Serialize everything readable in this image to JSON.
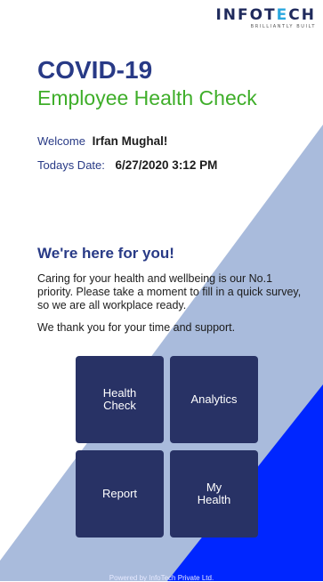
{
  "logo": {
    "word_start": "INFOT",
    "word_accent": "E",
    "word_end": "CH",
    "tagline": "BRILLIANTLY BUILT"
  },
  "header": {
    "title": "COVID-19",
    "subtitle": "Employee Health Check"
  },
  "welcome": {
    "label": "Welcome",
    "name": "Irfan Mughal!"
  },
  "date": {
    "label": "Todays Date:",
    "value": "6/27/2020 3:12 PM"
  },
  "message": {
    "heading": "We're here for you!",
    "body": "Caring for your health and wellbeing is our No.1 priority. Please take a moment to fill in a quick survey, so we are all workplace ready.",
    "thanks": "We thank you for your time and support."
  },
  "tiles": [
    {
      "label": "Health\nCheck"
    },
    {
      "label": "Analytics"
    },
    {
      "label": "Report"
    },
    {
      "label": "My\nHealth"
    }
  ],
  "footer": "Powered by InfoTech Private Ltd.",
  "colors": {
    "primary": "#283a86",
    "accent_green": "#3fae2a",
    "tile": "#283265",
    "blue_band": "#0026ff",
    "light_band": "#a9bbdc"
  }
}
